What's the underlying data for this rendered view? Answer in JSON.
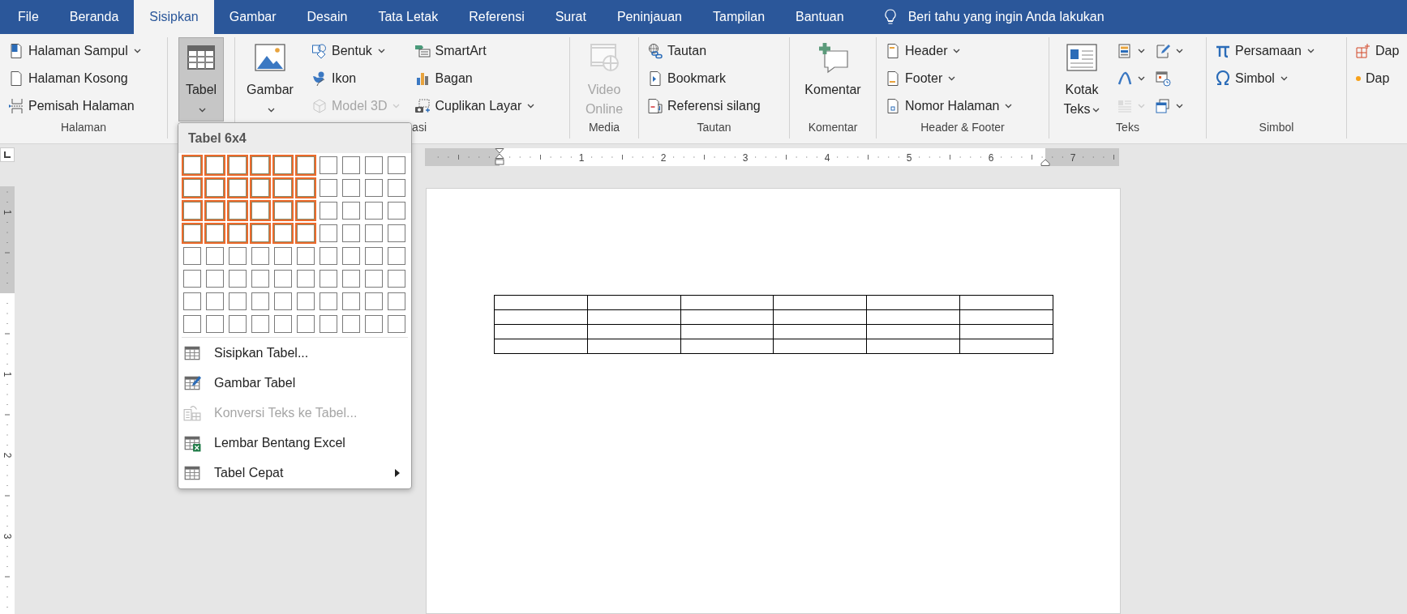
{
  "tabs": [
    {
      "label": "File",
      "selected": false
    },
    {
      "label": "Beranda",
      "selected": false
    },
    {
      "label": "Sisipkan",
      "selected": true
    },
    {
      "label": "Gambar",
      "selected": false
    },
    {
      "label": "Desain",
      "selected": false
    },
    {
      "label": "Tata Letak",
      "selected": false
    },
    {
      "label": "Referensi",
      "selected": false
    },
    {
      "label": "Surat",
      "selected": false
    },
    {
      "label": "Peninjauan",
      "selected": false
    },
    {
      "label": "Tampilan",
      "selected": false
    },
    {
      "label": "Bantuan",
      "selected": false
    }
  ],
  "tell_me": {
    "placeholder": "Beri tahu yang ingin Anda lakukan"
  },
  "ribbon": {
    "groups": [
      {
        "label": "Halaman",
        "columns": [
          {
            "kind": "stack",
            "items": [
              {
                "label": "Halaman Sampul",
                "dropdown": true,
                "disabled": false
              },
              {
                "label": "Halaman Kosong",
                "dropdown": false,
                "disabled": false
              },
              {
                "label": "Pemisah Halaman",
                "dropdown": false,
                "disabled": false
              }
            ]
          }
        ]
      },
      {
        "columns": [
          {
            "kind": "large",
            "items": [
              {
                "label": "Tabel",
                "dropdown": true,
                "disabled": false,
                "pressed": true
              }
            ]
          }
        ]
      },
      {
        "label": "asi",
        "label_clipped": true,
        "columns": [
          {
            "kind": "large",
            "items": [
              {
                "label": "Gambar",
                "dropdown": true,
                "disabled": false,
                "pressed": false
              }
            ]
          },
          {
            "kind": "stack",
            "items": [
              {
                "label": "Bentuk",
                "dropdown": true,
                "disabled": false
              },
              {
                "label": "Ikon",
                "dropdown": false,
                "disabled": false
              },
              {
                "label": "Model 3D",
                "dropdown": true,
                "disabled": true
              }
            ]
          },
          {
            "kind": "stack",
            "items": [
              {
                "label": "SmartArt",
                "dropdown": false,
                "disabled": false
              },
              {
                "label": "Bagan",
                "dropdown": false,
                "disabled": false
              },
              {
                "label": "Cuplikan Layar",
                "dropdown": true,
                "disabled": false
              }
            ]
          }
        ]
      },
      {
        "label": "Media",
        "columns": [
          {
            "kind": "large",
            "items": [
              {
                "label": "Video Online",
                "dropdown": false,
                "disabled": true,
                "pressed": false
              }
            ]
          }
        ]
      },
      {
        "label": "Tautan",
        "columns": [
          {
            "kind": "stack",
            "items": [
              {
                "label": "Tautan",
                "dropdown": false,
                "disabled": false
              },
              {
                "label": "Bookmark",
                "dropdown": false,
                "disabled": false
              },
              {
                "label": "Referensi silang",
                "dropdown": false,
                "disabled": false
              }
            ]
          }
        ]
      },
      {
        "label": "Komentar",
        "columns": [
          {
            "kind": "large",
            "items": [
              {
                "label": "Komentar",
                "dropdown": false,
                "disabled": false,
                "pressed": false
              }
            ]
          }
        ]
      },
      {
        "label": "Header & Footer",
        "columns": [
          {
            "kind": "stack",
            "items": [
              {
                "label": "Header",
                "dropdown": true,
                "disabled": false
              },
              {
                "label": "Footer",
                "dropdown": true,
                "disabled": false
              },
              {
                "label": "Nomor Halaman",
                "dropdown": true,
                "disabled": false
              }
            ]
          }
        ]
      },
      {
        "label": "Teks",
        "columns": [
          {
            "kind": "large",
            "items": [
              {
                "label": "Kotak Teks",
                "dropdown": true,
                "disabled": false,
                "pressed": false
              }
            ]
          },
          {
            "kind": "stack",
            "items": [
              {
                "dropdown": true,
                "disabled": false
              },
              {
                "dropdown": true,
                "disabled": false
              },
              {
                "dropdown": true,
                "disabled": true
              }
            ]
          },
          {
            "kind": "stack",
            "items": [
              {
                "dropdown": true,
                "disabled": false
              },
              {
                "dropdown": false,
                "disabled": false
              },
              {
                "dropdown": true,
                "disabled": false
              }
            ]
          }
        ]
      },
      {
        "label": "Simbol",
        "columns": [
          {
            "kind": "stack",
            "items": [
              {
                "label": "Persamaan",
                "dropdown": true,
                "disabled": false
              },
              {
                "label": "Simbol",
                "dropdown": true,
                "disabled": false
              }
            ]
          }
        ]
      },
      {
        "columns": [
          {
            "kind": "stack",
            "items": [
              {
                "label": "Dap",
                "dropdown": false,
                "disabled": false
              },
              {
                "label": "Dap",
                "dropdown": false,
                "disabled": false
              }
            ]
          }
        ]
      }
    ]
  },
  "table_menu": {
    "title": "Tabel 6x4",
    "grid": [
      {
        "cells": [
          {
            "selected": true
          },
          {
            "selected": true
          },
          {
            "selected": true
          },
          {
            "selected": true
          },
          {
            "selected": true
          },
          {
            "selected": true
          },
          {
            "selected": false
          },
          {
            "selected": false
          },
          {
            "selected": false
          },
          {
            "selected": false
          }
        ]
      },
      {
        "cells": [
          {
            "selected": true
          },
          {
            "selected": true
          },
          {
            "selected": true
          },
          {
            "selected": true
          },
          {
            "selected": true
          },
          {
            "selected": true
          },
          {
            "selected": false
          },
          {
            "selected": false
          },
          {
            "selected": false
          },
          {
            "selected": false
          }
        ]
      },
      {
        "cells": [
          {
            "selected": true
          },
          {
            "selected": true
          },
          {
            "selected": true
          },
          {
            "selected": true
          },
          {
            "selected": true
          },
          {
            "selected": true
          },
          {
            "selected": false
          },
          {
            "selected": false
          },
          {
            "selected": false
          },
          {
            "selected": false
          }
        ]
      },
      {
        "cells": [
          {
            "selected": true
          },
          {
            "selected": true
          },
          {
            "selected": true
          },
          {
            "selected": true
          },
          {
            "selected": true
          },
          {
            "selected": true
          },
          {
            "selected": false
          },
          {
            "selected": false
          },
          {
            "selected": false
          },
          {
            "selected": false
          }
        ]
      },
      {
        "cells": [
          {
            "selected": false
          },
          {
            "selected": false
          },
          {
            "selected": false
          },
          {
            "selected": false
          },
          {
            "selected": false
          },
          {
            "selected": false
          },
          {
            "selected": false
          },
          {
            "selected": false
          },
          {
            "selected": false
          },
          {
            "selected": false
          }
        ]
      },
      {
        "cells": [
          {
            "selected": false
          },
          {
            "selected": false
          },
          {
            "selected": false
          },
          {
            "selected": false
          },
          {
            "selected": false
          },
          {
            "selected": false
          },
          {
            "selected": false
          },
          {
            "selected": false
          },
          {
            "selected": false
          },
          {
            "selected": false
          }
        ]
      },
      {
        "cells": [
          {
            "selected": false
          },
          {
            "selected": false
          },
          {
            "selected": false
          },
          {
            "selected": false
          },
          {
            "selected": false
          },
          {
            "selected": false
          },
          {
            "selected": false
          },
          {
            "selected": false
          },
          {
            "selected": false
          },
          {
            "selected": false
          }
        ]
      },
      {
        "cells": [
          {
            "selected": false
          },
          {
            "selected": false
          },
          {
            "selected": false
          },
          {
            "selected": false
          },
          {
            "selected": false
          },
          {
            "selected": false
          },
          {
            "selected": false
          },
          {
            "selected": false
          },
          {
            "selected": false
          },
          {
            "selected": false
          }
        ]
      }
    ],
    "items": [
      {
        "label": "Sisipkan Tabel...",
        "disabled": false,
        "submenu": false
      },
      {
        "label": "Gambar Tabel",
        "disabled": false,
        "submenu": false
      },
      {
        "label": "Konversi Teks ke Tabel...",
        "disabled": true,
        "submenu": false
      },
      {
        "label": "Lembar Bentang Excel",
        "disabled": false,
        "submenu": false
      },
      {
        "label": "Tabel Cepat",
        "disabled": false,
        "submenu": true
      }
    ]
  },
  "ruler": {
    "labels": [
      "1",
      "2",
      "3",
      "4",
      "5",
      "6",
      "7"
    ]
  },
  "vertical_ruler": {
    "labels": [
      "1",
      "1",
      "2",
      "3"
    ]
  },
  "document": {
    "table": {
      "rows": [
        {
          "cells": [
            {
              "kind": "empty"
            },
            {
              "kind": "empty"
            },
            {
              "kind": "empty"
            },
            {
              "kind": "empty"
            },
            {
              "kind": "empty"
            },
            {
              "kind": "empty"
            }
          ]
        },
        {
          "cells": [
            {
              "kind": "empty"
            },
            {
              "kind": "empty"
            },
            {
              "kind": "empty"
            },
            {
              "kind": "empty"
            },
            {
              "kind": "empty"
            },
            {
              "kind": "empty"
            }
          ]
        },
        {
          "cells": [
            {
              "kind": "empty"
            },
            {
              "kind": "empty"
            },
            {
              "kind": "empty"
            },
            {
              "kind": "empty"
            },
            {
              "kind": "empty"
            },
            {
              "kind": "empty"
            }
          ]
        },
        {
          "cells": [
            {
              "kind": "empty"
            },
            {
              "kind": "empty"
            },
            {
              "kind": "empty"
            },
            {
              "kind": "empty"
            },
            {
              "kind": "empty"
            },
            {
              "kind": "empty"
            }
          ]
        }
      ]
    }
  }
}
